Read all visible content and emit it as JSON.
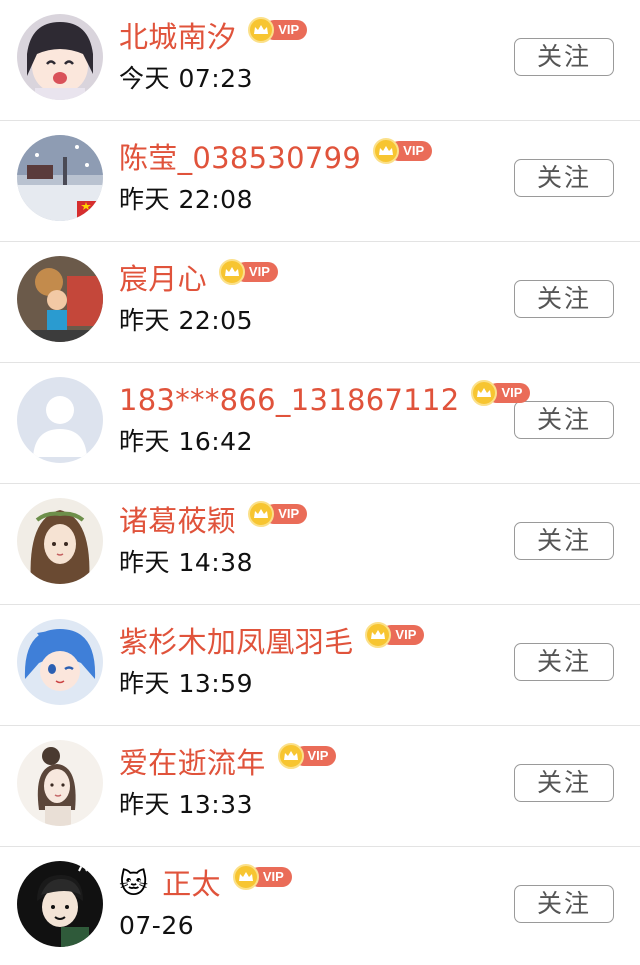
{
  "vip_label": "VIP",
  "follow_label": "关注",
  "colors": {
    "name": "#e0533b",
    "vip_tag": "#ea6c58",
    "vip_crown": "#f7c531",
    "divider": "#e3e3e3"
  },
  "users": [
    {
      "name": "北城南汐",
      "time": "今天 07:23",
      "avatar_icon": "anime-girl-avatar-icon"
    },
    {
      "name": "陈莹_038530799",
      "time": "昨天 22:08",
      "avatar_icon": "snow-scene-avatar-icon"
    },
    {
      "name": "宸月心",
      "time": "昨天 22:05",
      "avatar_icon": "child-photo-avatar-icon"
    },
    {
      "name": "183***866_131867112",
      "time": "昨天 16:42",
      "avatar_icon": "default-person-avatar-icon"
    },
    {
      "name": "诸葛莜颖",
      "time": "昨天 14:38",
      "avatar_icon": "illustrated-girl-avatar-icon"
    },
    {
      "name": "紫杉木加凤凰羽毛",
      "time": "昨天 13:59",
      "avatar_icon": "blue-hair-anime-avatar-icon"
    },
    {
      "name": "爱在逝流年",
      "time": "昨天 13:33",
      "avatar_icon": "sketch-girl-avatar-icon"
    },
    {
      "name": "正太",
      "emoji": "🐱",
      "time": "07-26",
      "avatar_icon": "cartoon-boy-avatar-icon"
    }
  ]
}
